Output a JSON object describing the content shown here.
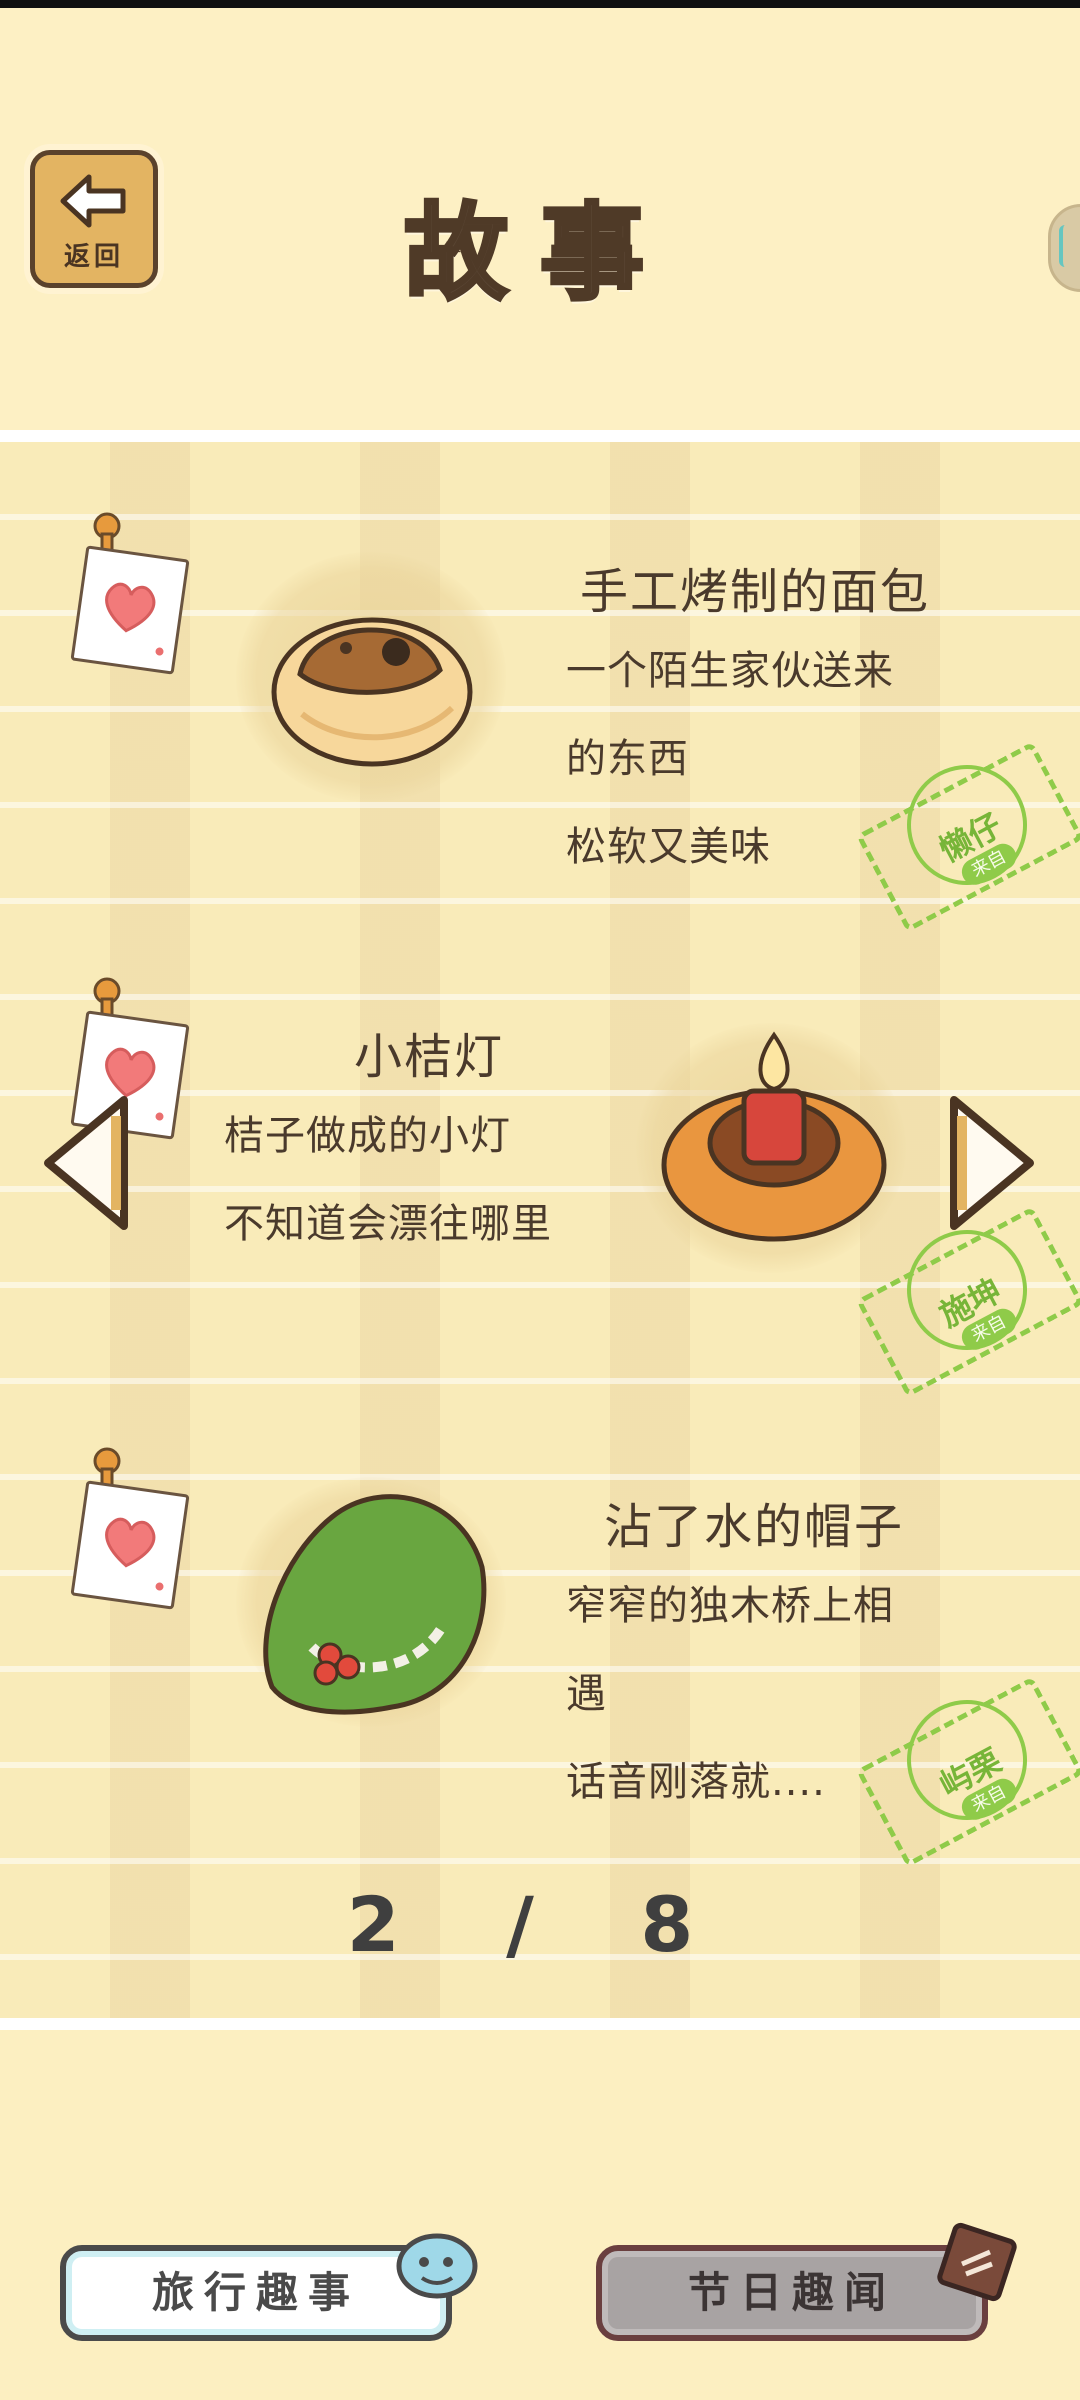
{
  "header": {
    "back_label": "返回",
    "title": "故事"
  },
  "stories": [
    {
      "title": "手工烤制的面包",
      "lines": [
        "一个陌生家伙送来",
        "的东西",
        "松软又美味"
      ],
      "stamp_name": "懒仔",
      "stamp_sub": "来自",
      "food_icon": "bread-icon"
    },
    {
      "title": "小桔灯",
      "lines": [
        "桔子做成的小灯",
        "不知道会漂往哪里"
      ],
      "stamp_name": "施坤",
      "stamp_sub": "来自",
      "food_icon": "orange-lamp-icon"
    },
    {
      "title": "沾了水的帽子",
      "lines": [
        "窄窄的独木桥上相",
        "遇",
        "话音刚落就...."
      ],
      "stamp_name": "屿栗",
      "stamp_sub": "来自",
      "food_icon": "wet-hat-icon"
    }
  ],
  "pager": {
    "current": "2",
    "separator": "/",
    "total": "8",
    "text": "2 / 8"
  },
  "bottom": {
    "travel_label": "旅行趣事",
    "festival_label": "节日趣闻"
  },
  "colors": {
    "background": "#fcefc1",
    "stamp_green": "#8fcb49",
    "text": "#4a3a2c"
  }
}
